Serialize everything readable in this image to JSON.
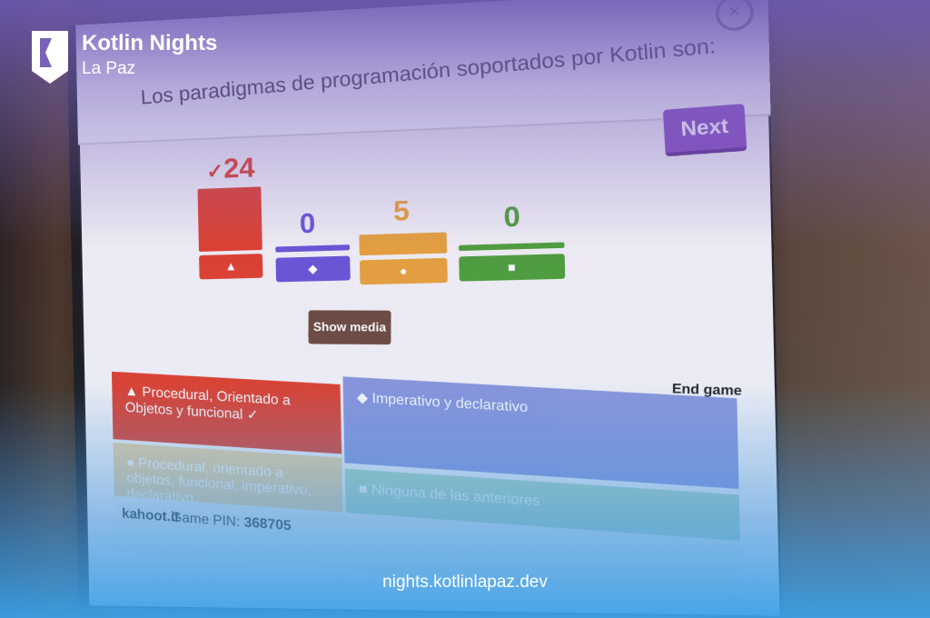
{
  "brand": {
    "title": "Kotlin Nights",
    "subtitle": "La Paz",
    "url": "nights.kotlinlapaz.dev"
  },
  "kahoot": {
    "question": "Los paradigmas de programación soportados por Kotlin son:",
    "next_label": "Next",
    "show_media_label": "Show media",
    "end_game_label": "End game",
    "results": [
      {
        "count": "24",
        "correct_mark": "✓",
        "shape": "▲",
        "color": "#e0402f",
        "value": 24
      },
      {
        "count": "0",
        "shape": "◆",
        "color": "#6a55d6",
        "value": 0
      },
      {
        "count": "5",
        "shape": "●",
        "color": "#e8a23a",
        "value": 5
      },
      {
        "count": "0",
        "shape": "■",
        "color": "#4f9f3a",
        "value": 0
      }
    ],
    "answers": [
      {
        "shape": "▲",
        "text": "Procedural, Orientado a Objetos y funcional",
        "mark": "✓"
      },
      {
        "shape": "◆",
        "text": "Imperativo y declarativo"
      },
      {
        "shape": "●",
        "text": "Procedural, orientado a objetos, funcional, imperativo, declarativo."
      },
      {
        "shape": "■",
        "text": "Ninguna de las anteriores"
      }
    ],
    "footer": {
      "site": "kahoot.it",
      "pin_label": "Game PIN:",
      "pin": "368705"
    }
  }
}
